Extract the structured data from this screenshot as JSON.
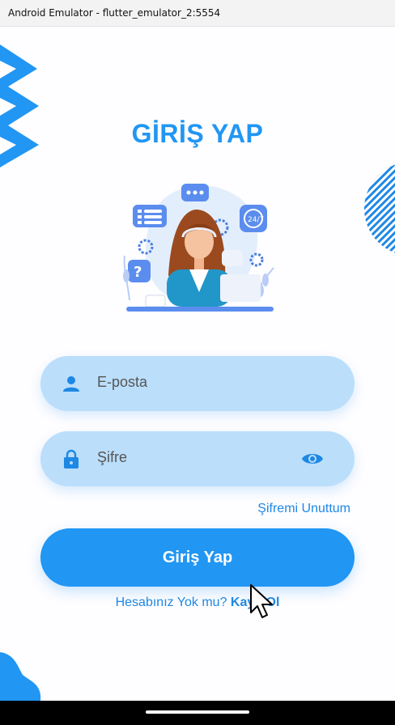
{
  "window": {
    "title": "Android Emulator - flutter_emulator_2:5554"
  },
  "page": {
    "title": "GİRİŞ YAP"
  },
  "form": {
    "email_placeholder": "E-posta",
    "password_placeholder": "Şifre",
    "forgot_password": "Şifremi Unuttum",
    "login_button": "Giriş Yap"
  },
  "signup": {
    "prompt": "Hesabınız Yok mu?",
    "link": "Kayıt Ol"
  },
  "icons": {
    "email": "person-icon",
    "password": "lock-icon",
    "toggle": "eye-icon"
  },
  "colors": {
    "primary": "#2196f3",
    "field_bg": "#bbdefb",
    "text_link": "#1e88e5"
  }
}
